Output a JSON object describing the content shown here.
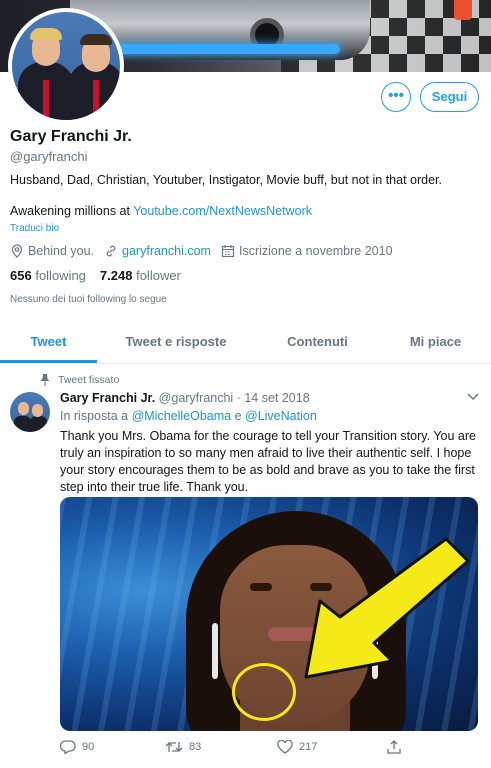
{
  "profile": {
    "name": "Gary Franchi Jr.",
    "handle": "@garyfranchi",
    "bio": "Husband, Dad, Christian, Youtuber, Instigator, Movie buff, but not in that order.",
    "bio_line2_prefix": "Awakening millions at ",
    "bio_line2_link": "Youtube.com/NextNewsNetwork",
    "translate": "Traduci bio",
    "location": "Behind you.",
    "website": "garyfranchi.com",
    "joined": "Iscrizione a novembre 2010",
    "following_count": "656",
    "following_label": "following",
    "followers_count": "7.248",
    "followers_label": "follower",
    "no_followers_known": "Nessuno dei tuoi following lo segue",
    "more_button": "•••",
    "follow_button": "Segui"
  },
  "tabs": [
    {
      "label": "Tweet",
      "active": true
    },
    {
      "label": "Tweet e risposte",
      "active": false
    },
    {
      "label": "Contenuti",
      "active": false
    },
    {
      "label": "Mi piace",
      "active": false
    }
  ],
  "tweet": {
    "pinned_label": "Tweet fissato",
    "author_name": "Gary Franchi Jr.",
    "author_handle": "@garyfranchi",
    "date": "· 14 set 2018",
    "reply_prefix": "In risposta a ",
    "reply_to_1": "@MichelleObama",
    "reply_join": " e ",
    "reply_to_2": "@LiveNation",
    "text": "Thank you Mrs. Obama for the courage to tell your Transition story. You are truly an inspiration to so many men afraid to live their authentic self. I hope your story encourages them to be as bold and brave as you to take the first step into their true life. Thank you.",
    "replies": "90",
    "retweets": "83",
    "likes": "217"
  },
  "colors": {
    "accent": "#1da1f2",
    "link": "#1b95e0",
    "muted": "#657786",
    "annotation": "#f5ea17"
  }
}
